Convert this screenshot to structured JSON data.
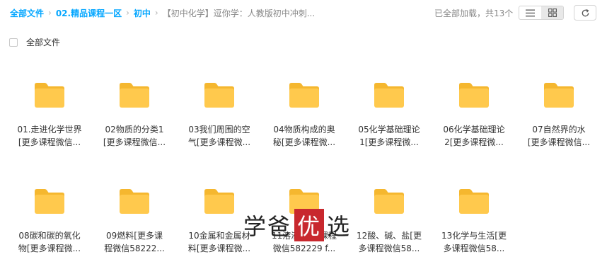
{
  "breadcrumb": {
    "root": "全部文件",
    "level1": "02.精品课程一区",
    "level2": "初中",
    "current": "【初中化学】逗你学：人教版初中冲刺..."
  },
  "status_text": "已全部加载，共13个",
  "select_all_label": "全部文件",
  "files": [
    {
      "line1": "01.走进化学世界",
      "line2": "[更多课程微信..."
    },
    {
      "line1": "02物质的分类1",
      "line2": "[更多课程微信..."
    },
    {
      "line1": "03我们周围的空",
      "line2": "气[更多课程微..."
    },
    {
      "line1": "04物质构成的奥",
      "line2": "秘[更多课程微..."
    },
    {
      "line1": "05化学基础理论",
      "line2": "1[更多课程微..."
    },
    {
      "line1": "06化学基础理论",
      "line2": "2[更多课程微..."
    },
    {
      "line1": "07自然界的水",
      "line2": "[更多课程微信..."
    },
    {
      "line1": "08碳和碳的氧化",
      "line2": "物[更多课程微..."
    },
    {
      "line1": "09燃料[更多课",
      "line2": "程微信58222..."
    },
    {
      "line1": "10金属和金属材",
      "line2": "料[更多课程微..."
    },
    {
      "line1": "11溶液[更多课程",
      "line2": "微信582229 f..."
    },
    {
      "line1": "12酸、碱、盐[更",
      "line2": "多课程微信58..."
    },
    {
      "line1": "13化学与生活[更",
      "line2": "多课程微信58..."
    }
  ],
  "watermark": {
    "part1": "学爸",
    "part2": "优",
    "part3": "选"
  },
  "colors": {
    "accent": "#06a7ff",
    "folder": "#ffc94d",
    "folder_tab": "#f5b72f"
  }
}
